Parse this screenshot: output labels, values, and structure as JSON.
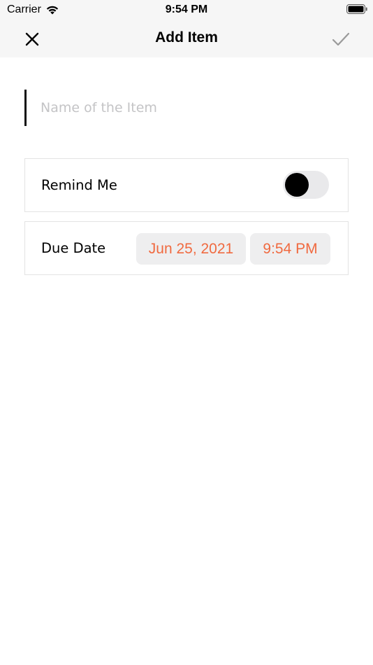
{
  "status_bar": {
    "carrier": "Carrier",
    "time": "9:54 PM",
    "wifi_icon": "wifi-icon",
    "battery_icon": "battery-icon"
  },
  "nav": {
    "title": "Add Item",
    "close_icon": "close-icon",
    "done_icon": "checkmark-icon"
  },
  "form": {
    "name_field": {
      "value": "",
      "placeholder": "Name of the Item"
    },
    "remind": {
      "label": "Remind Me",
      "enabled": false
    },
    "due": {
      "label": "Due Date",
      "date": "Jun 25, 2021",
      "time": "9:54 PM"
    }
  },
  "colors": {
    "accent": "#f06a40",
    "bar_background": "#f6f6f6",
    "pill_background": "#eeeeef",
    "toggle_track": "#e9e9eb"
  }
}
